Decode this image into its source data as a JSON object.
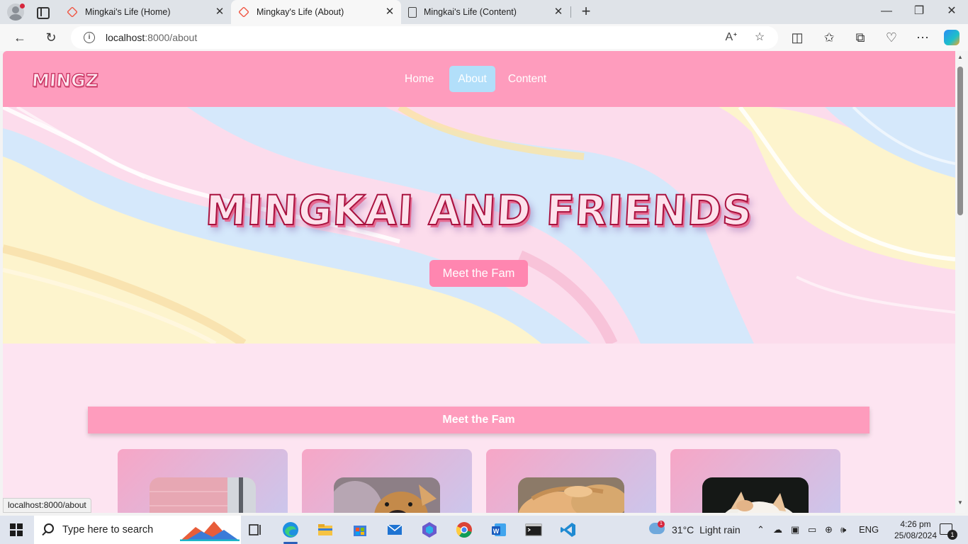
{
  "browser": {
    "tabs": [
      {
        "title": "Mingkai's Life (Home)",
        "active": false
      },
      {
        "title": "Mingkay's Life (About)",
        "active": true
      },
      {
        "title": "Mingkai's Life (Content)",
        "active": false
      }
    ],
    "url_host": "localhost",
    "url_path": ":8000/about",
    "status_url": "localhost:8000/about"
  },
  "site": {
    "logo": "MINGZ",
    "nav": [
      {
        "label": "Home",
        "active": false
      },
      {
        "label": "About",
        "active": true
      },
      {
        "label": "Content",
        "active": false
      }
    ],
    "hero": {
      "title": "MINGKAI AND FRIENDS",
      "button": "Meet the Fam"
    },
    "section_title": "Meet the Fam",
    "cards": [
      {
        "photo": "pink-wall-photo"
      },
      {
        "photo": "dog-photo"
      },
      {
        "photo": "orange-cat-photo"
      },
      {
        "photo": "white-cat-photo"
      }
    ],
    "colors": {
      "navbar": "#fe9cbd",
      "active_nav": "#b2dffa",
      "page_bg": "#fde4f1",
      "button": "#ff86b0"
    }
  },
  "taskbar": {
    "search_placeholder": "Type here to search",
    "weather_temp": "31°C",
    "weather_desc": "Light rain",
    "weather_badge": "1",
    "language": "ENG",
    "time": "4:26 pm",
    "date": "25/08/2024",
    "notifications": "1"
  }
}
